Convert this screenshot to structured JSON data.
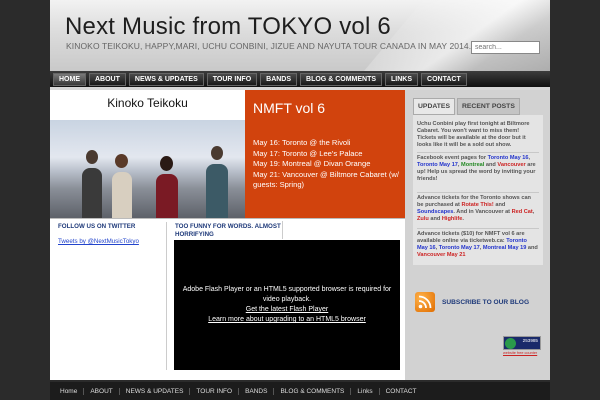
{
  "header": {
    "title": "Next Music from TOKYO vol 6",
    "tagline": "KINOKO TEIKOKU, HAPPY,MARI, UCHU CONBINI, JIZUE AND NAYUTA TOUR CANADA IN MAY 2014.",
    "search_placeholder": "search..."
  },
  "nav": {
    "items": [
      "HOME",
      "ABOUT",
      "NEWS & UPDATES",
      "TOUR INFO",
      "BANDS",
      "BLOG & COMMENTS",
      "LINKS",
      "CONTACT"
    ],
    "active": "HOME"
  },
  "feature": {
    "band_name": "Kinoko Teikoku",
    "panel_title": "NMFT vol 6",
    "dates": [
      "May 16: Toronto @ the Rivoli",
      "May 17: Toronto @ Lee's Palace",
      "May 19: Montreal @ Divan Orange",
      "May 21: Vancouver @ Biltmore Cabaret (w/ guests: Spring)"
    ],
    "panel_color": "#d1430d"
  },
  "twitter": {
    "heading": "FOLLOW US ON TWITTER",
    "link": "Tweets by @NextMusicTokyo"
  },
  "post": {
    "title": "TOO FUNNY FOR WORDS. ALMOST HORRIFYING"
  },
  "player": {
    "message": "Adobe Flash Player or an HTML5 supported browser is required for video playback.",
    "link1": "Get the latest Flash Player",
    "link2": "Learn more about upgrading to an HTML5 browser"
  },
  "sidebar": {
    "tabs": [
      "UPDATES",
      "RECENT POSTS"
    ],
    "active_tab": "UPDATES",
    "updates": [
      {
        "parts": [
          {
            "t": "Uchu Conbini play first tonight at Biltmore Cabaret. You won't want to miss them! Tickets will be available at the door but it looks like it will be a sold out show.",
            "c": ""
          }
        ]
      },
      {
        "parts": [
          {
            "t": "Facebook event pages for ",
            "c": ""
          },
          {
            "t": "Toronto May 16",
            "c": "hl-blue"
          },
          {
            "t": ", ",
            "c": ""
          },
          {
            "t": "Toronto May 17",
            "c": "hl-blue"
          },
          {
            "t": ", ",
            "c": ""
          },
          {
            "t": "Montreal",
            "c": "hl-green"
          },
          {
            "t": " and ",
            "c": ""
          },
          {
            "t": "Vancouver",
            "c": "hl-red"
          },
          {
            "t": " are up! Help us spread the word by inviting your friends!",
            "c": ""
          }
        ]
      },
      {
        "parts": [
          {
            "t": "Advance tickets for the Toronto shows can be purchased at ",
            "c": ""
          },
          {
            "t": "Rotate This!",
            "c": "hl-red"
          },
          {
            "t": " and ",
            "c": ""
          },
          {
            "t": "Soundscapes",
            "c": "hl-blue"
          },
          {
            "t": ". And in Vancouver at ",
            "c": ""
          },
          {
            "t": "Red Cat",
            "c": "hl-red"
          },
          {
            "t": ", ",
            "c": ""
          },
          {
            "t": "Zulu",
            "c": "hl-red"
          },
          {
            "t": " and ",
            "c": ""
          },
          {
            "t": "Highlife",
            "c": "hl-red"
          },
          {
            "t": ".",
            "c": ""
          }
        ]
      },
      {
        "parts": [
          {
            "t": "Advance tickets ($10) for NMFT vol 6 are available online via ticketweb.ca: ",
            "c": ""
          },
          {
            "t": "Toronto May 16",
            "c": "hl-blue"
          },
          {
            "t": ", ",
            "c": ""
          },
          {
            "t": "Toronto May 17",
            "c": "hl-blue"
          },
          {
            "t": ", ",
            "c": ""
          },
          {
            "t": "Montreal May 19",
            "c": "hl-blue"
          },
          {
            "t": " and ",
            "c": ""
          },
          {
            "t": "Vancouver May 21",
            "c": "hl-red"
          }
        ]
      }
    ],
    "subscribe": "SUBSCRIBE TO OUR BLOG",
    "counter_value": "253985",
    "counter_caption": "website free counter"
  },
  "footer": {
    "items": [
      "Home",
      "ABOUT",
      "NEWS & UPDATES",
      "TOUR INFO",
      "BANDS",
      "BLOG & COMMENTS",
      "Links",
      "CONTACT"
    ]
  }
}
